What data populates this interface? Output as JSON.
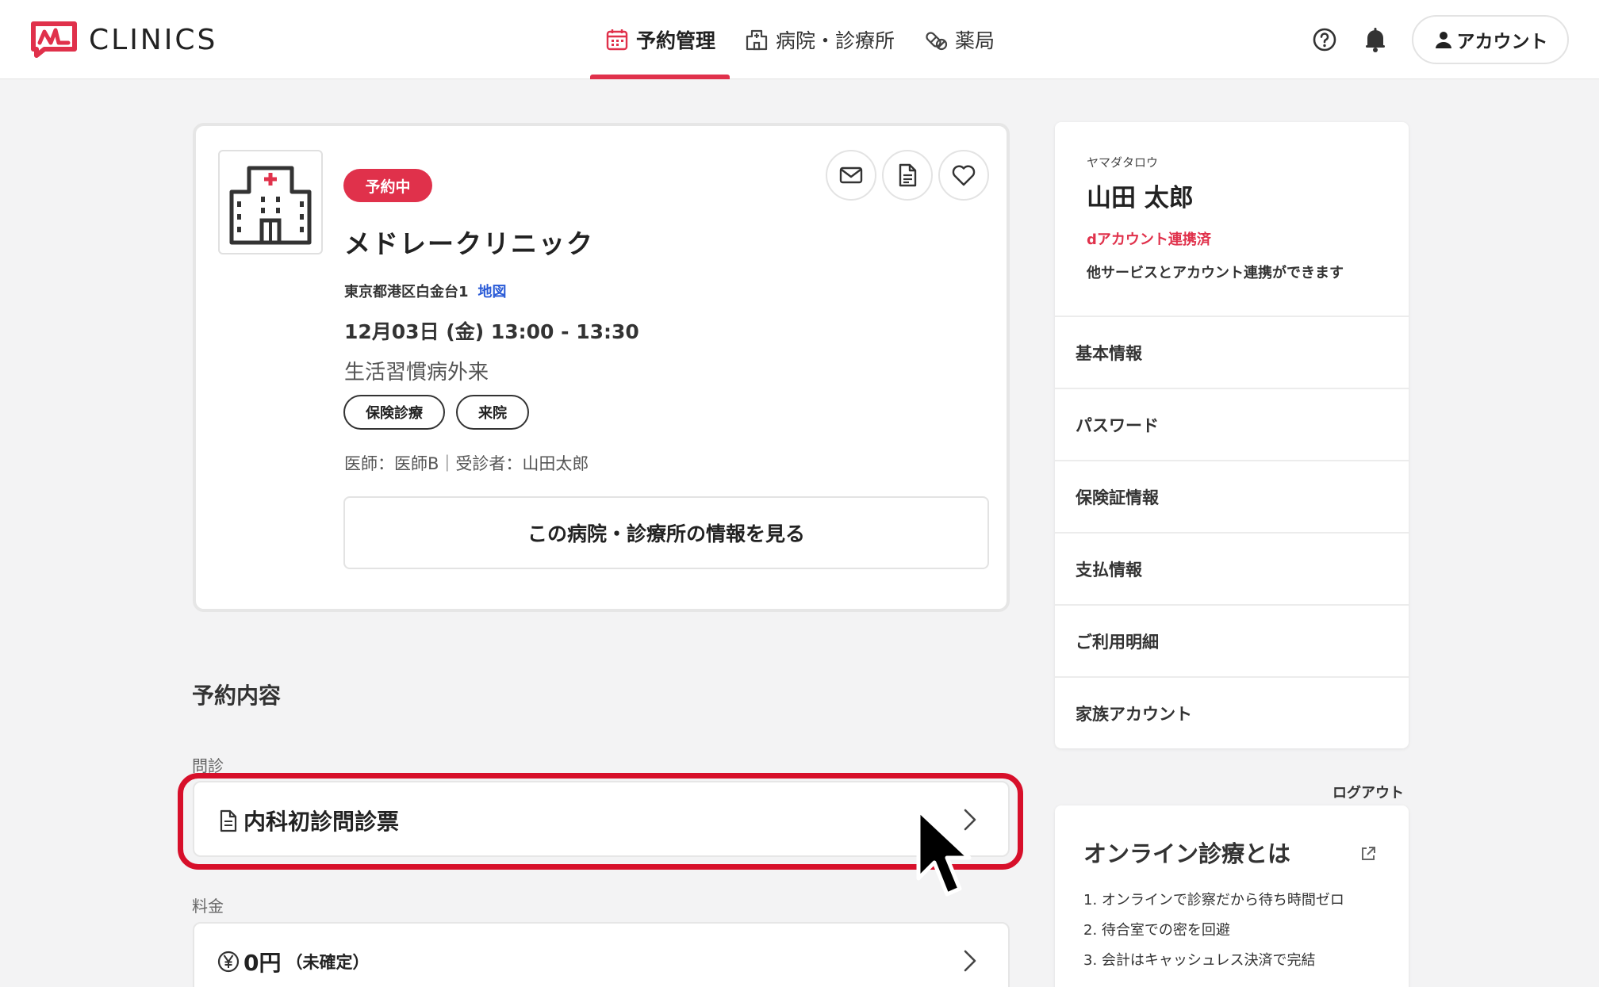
{
  "header": {
    "brand": "CLINICS",
    "nav": [
      {
        "label": "予約管理",
        "icon": "calendar-icon",
        "active": true
      },
      {
        "label": "病院・診療所",
        "icon": "hospital-icon",
        "active": false
      },
      {
        "label": "薬局",
        "icon": "pill-icon",
        "active": false
      }
    ],
    "account_label": "アカウント"
  },
  "appointment": {
    "status": "予約中",
    "clinic_name": "メドレークリニック",
    "address": "東京都港区白金台1",
    "map_link": "地図",
    "datetime": "12月03日 (金) 13:00 - 13:30",
    "department": "生活習慣病外来",
    "tags": [
      "保険診療",
      "来院"
    ],
    "staff": "医師：医師B｜受診者：山田太郎",
    "info_button": "この病院・診療所の情報を見る"
  },
  "details": {
    "section_title": "予約内容",
    "questionnaire_label": "問診",
    "questionnaire_item": "内科初診問診票",
    "fee_label": "料金",
    "fee_amount": "0円",
    "fee_note": "（未確定）"
  },
  "profile": {
    "kana": "ヤマダタロウ",
    "name": "山田 太郎",
    "d_account": "dアカウント連携済",
    "d_account_note": "他サービスとアカウント連携ができます",
    "menu": [
      "基本情報",
      "パスワード",
      "保険証情報",
      "支払情報",
      "ご利用明細",
      "家族アカウント"
    ],
    "logout": "ログアウト"
  },
  "online": {
    "title": "オンライン診療とは",
    "points": [
      "1. オンラインで診察だから待ち時間ゼロ",
      "2. 待合室での密を回避",
      "3. 会計はキャッシュレス決済で完結"
    ]
  },
  "colors": {
    "accent": "#e0314b",
    "highlight": "#d70f2a",
    "link": "#2a5bd7"
  }
}
